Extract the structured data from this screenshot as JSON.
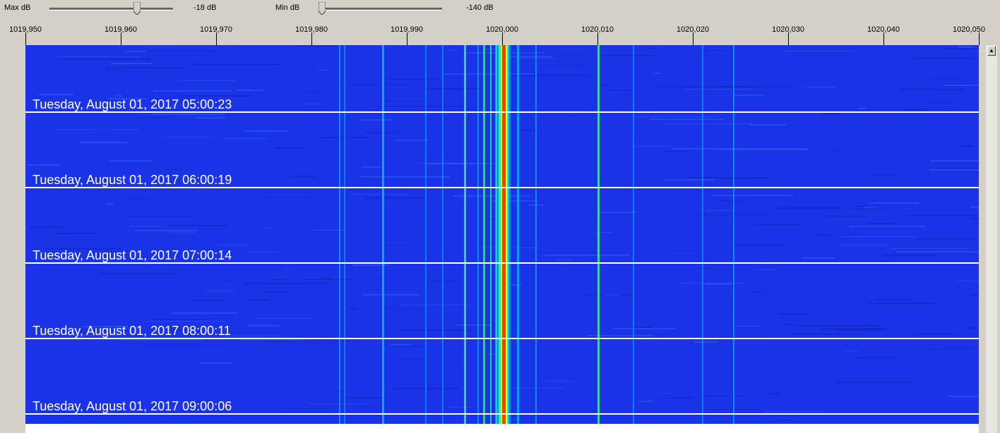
{
  "controls": {
    "max_db": {
      "label": "Max dB",
      "value": "-18 dB",
      "level": 0.72
    },
    "min_db": {
      "label": "Min dB",
      "value": "-140 dB",
      "level": 0.0
    }
  },
  "frequency_axis": {
    "ticks": [
      "1019,950",
      "1019,960",
      "1019,970",
      "1019,980",
      "1019,990",
      "1020,000",
      "1020,010",
      "1020,020",
      "1020,030",
      "1020,040",
      "1020,050"
    ]
  },
  "waterfall": {
    "timestamps": [
      "Tuesday, August 01, 2017 05:00:23",
      "Tuesday, August 01, 2017 06:00:19",
      "Tuesday, August 01, 2017 07:00:14",
      "Tuesday, August 01, 2017 08:00:11",
      "Tuesday, August 01, 2017 09:00:06"
    ],
    "colors": {
      "background": "#1a33e6",
      "signal_weak": "#00c8ff",
      "signal_mid": "#40ff80",
      "signal_strong": "#ffff00",
      "signal_peak": "#ff2000"
    }
  },
  "scrollbar": {
    "up_icon": "arrow-up-icon"
  }
}
